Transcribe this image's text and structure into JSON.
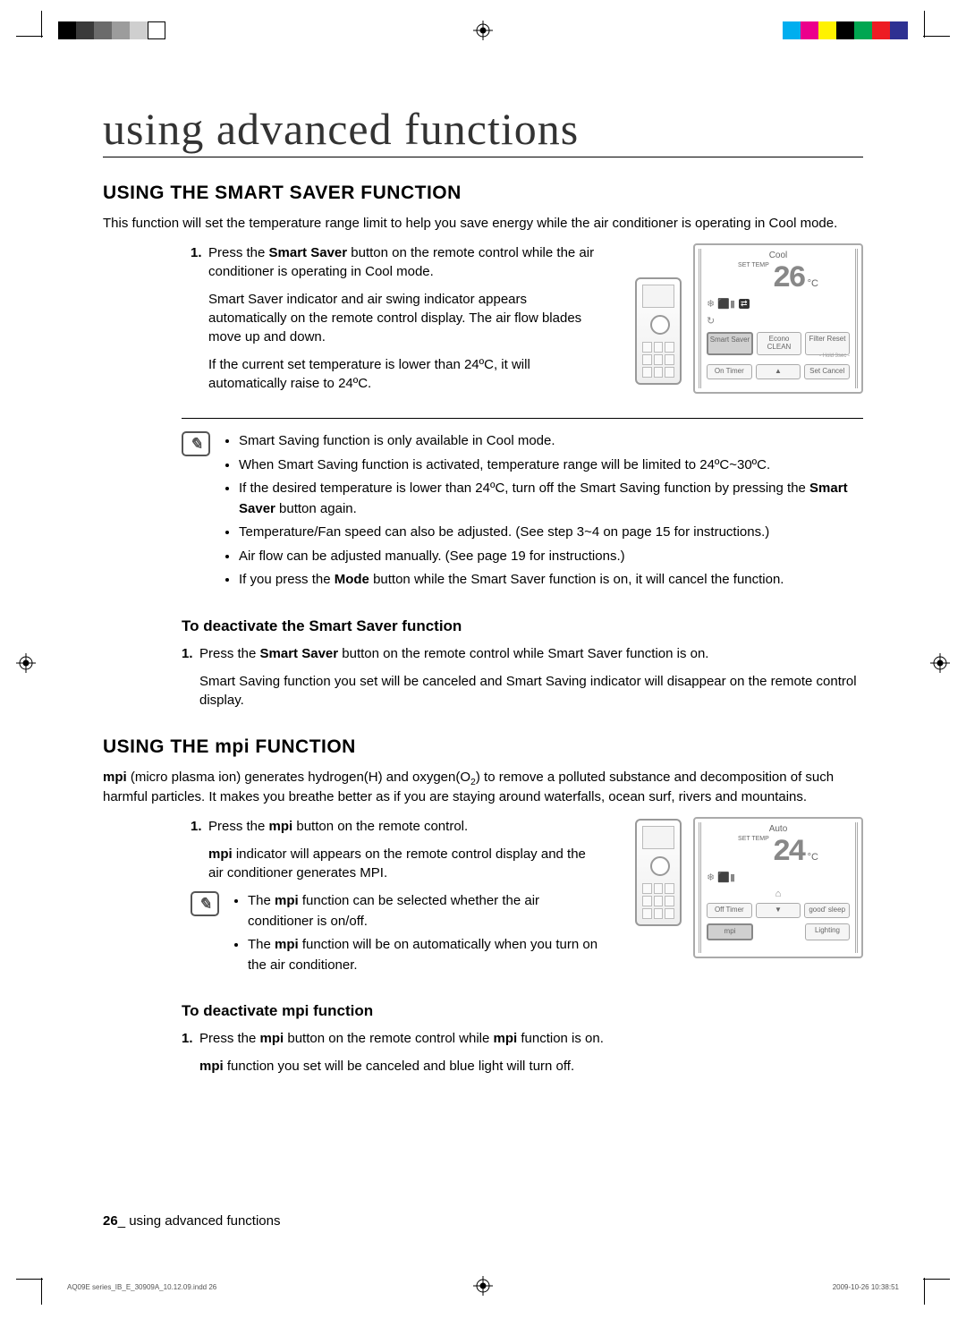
{
  "title": "using advanced functions",
  "section1": {
    "heading": "USING THE SMART SAVER FUNCTION",
    "intro": "This function will set the temperature range limit to help you save energy while the air conditioner is operating in Cool mode.",
    "step1_prefix": "Press the ",
    "step1_bold": "Smart Saver",
    "step1_suffix": " button on the remote control while the air conditioner is operating in Cool mode.",
    "sub1": "Smart Saver indicator and air swing indicator appears automatically on the remote control display. The air flow blades move up and down.",
    "sub2": "If the current set temperature is lower than 24ºC, it will automatically raise to 24ºC.",
    "notes": [
      "Smart Saving function is only available in Cool mode.",
      "When Smart Saving function is activated, temperature range will be limited to 24ºC~30ºC.",
      "If the desired temperature is lower than 24ºC, turn off the Smart Saving function by pressing the Smart Saver button again.",
      "Temperature/Fan speed can also be adjusted. (See step 3~4 on page 15 for instructions.)",
      "Air flow can be adjusted manually. (See page 19 for instructions.)",
      "If you press the Mode button while the Smart Saver function is on, it will cancel the function."
    ],
    "deact_heading": "To deactivate the Smart Saver function",
    "deact1_prefix": "Press the ",
    "deact1_bold": "Smart Saver",
    "deact1_suffix": " button on the remote control while Smart Saver function is on.",
    "deact_sub": "Smart Saving function you set will be canceled and Smart Saving indicator will disappear on the remote control display.",
    "lcd": {
      "mode": "Cool",
      "set_temp_label": "SET TEMP",
      "temp_value": "26",
      "unit": "°C",
      "btn_smart": "Smart Saver",
      "btn_econo": "Econo CLEAN",
      "btn_filter": "Filter Reset",
      "hold": "- Hold 3sec -",
      "btn_on": "On Timer",
      "btn_set": "Set Cancel"
    }
  },
  "section2": {
    "heading_pre": "USING THE ",
    "heading_post": " FUNCTION",
    "mpi": "mpi",
    "intro_pre": " (micro plasma ion) generates hydrogen(H) and oxygen(O",
    "intro_sub": "2",
    "intro_post": ") to remove a polluted substance and decomposition of such harmful particles. It makes you breathe better as if you are staying around waterfalls, ocean surf, rivers and mountains.",
    "step1_prefix": "Press the ",
    "step1_suffix": " button on the remote control.",
    "sub1_post": " indicator will appears on the remote control display and the air conditioner generates MPI.",
    "note1_pre": "The ",
    "note1_post": " function can be selected whether the air conditioner is on/off.",
    "note2_pre": "The ",
    "note2_post": " function will be on automatically when you turn on the air conditioner.",
    "deact_heading_pre": "To deactivate ",
    "deact_heading_post": " function",
    "deact1_prefix": "Press the ",
    "deact1_mid": " button on the remote control while ",
    "deact1_suffix": " function is on.",
    "deact_sub_post": " function you set will be canceled and blue light will turn off.",
    "lcd": {
      "mode": "Auto",
      "set_temp_label": "SET TEMP",
      "temp_value": "24",
      "unit": "°C",
      "btn_off": "Off Timer",
      "btn_good": "good' sleep",
      "btn_mpi": "mpi",
      "btn_light": "Lighting"
    }
  },
  "footer": {
    "page_num": "26",
    "footer_text": "_ using advanced functions"
  },
  "meta": {
    "file": "AQ09E series_IB_E_30909A_10.12.09.indd   26",
    "stamp": "2009-10-26   10:38:51"
  },
  "colorbar_left": [
    "#000",
    "#3a3a3a",
    "#6b6b6b",
    "#9c9c9c",
    "#cfcfcf",
    "#fff"
  ],
  "colorbar_right": [
    "#00aeef",
    "#ec008c",
    "#fff200",
    "#000",
    "#00a651",
    "#ed1c24",
    "#2e3192"
  ]
}
